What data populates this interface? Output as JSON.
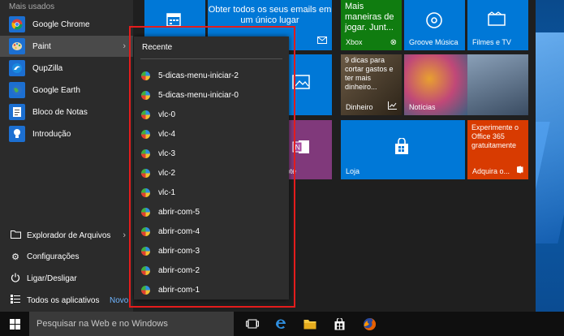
{
  "start_menu": {
    "most_used_label": "Mais usados",
    "apps": [
      {
        "label": "Google Chrome",
        "icon": "chrome-icon"
      },
      {
        "label": "Paint",
        "icon": "paint-icon"
      },
      {
        "label": "QupZilla",
        "icon": "qupzilla-icon"
      },
      {
        "label": "Google Earth",
        "icon": "google-earth-icon"
      },
      {
        "label": "Bloco de Notas",
        "icon": "notepad-icon"
      },
      {
        "label": "Introdução",
        "icon": "lightbulb-icon"
      }
    ],
    "system": [
      {
        "label": "Explorador de Arquivos",
        "icon": "folder-icon"
      },
      {
        "label": "Configurações",
        "icon": "gear-icon"
      },
      {
        "label": "Ligar/Desligar",
        "icon": "power-icon"
      },
      {
        "label": "Todos os aplicativos",
        "icon": "list-icon"
      }
    ],
    "new_badge": "Novo"
  },
  "jumplist": {
    "title": "Recente",
    "items": [
      "5-dicas-menu-iniciar-2",
      "5-dicas-menu-iniciar-0",
      "vlc-0",
      "vlc-4",
      "vlc-3",
      "vlc-2",
      "vlc-1",
      "abrir-com-5",
      "abrir-com-4",
      "abrir-com-3",
      "abrir-com-2",
      "abrir-com-1"
    ]
  },
  "tiles": {
    "mail_text": "Obter todos os seus emails em um único lugar",
    "xbox_text": "Mais maneiras de jogar. Junt...",
    "xbox_label": "Xbox",
    "groove_label": "Groove Música",
    "movies_label": "Filmes e TV",
    "money_text": "9 dicas para cortar gastos e ter mais dinheiro...",
    "money_label": "Dinheiro",
    "news_label": "Notícias",
    "onenote_label": "Note",
    "store_label": "Loja",
    "office_text": "Experimente o Office 365 gratuitamente",
    "office_label": "Adquira o...",
    "colors": {
      "blue": "#0078d7",
      "dark_blue": "#0063b1",
      "purple": "#80397b",
      "orange": "#d83b01"
    }
  },
  "taskbar": {
    "search_placeholder": "Pesquisar na Web e no Windows"
  }
}
